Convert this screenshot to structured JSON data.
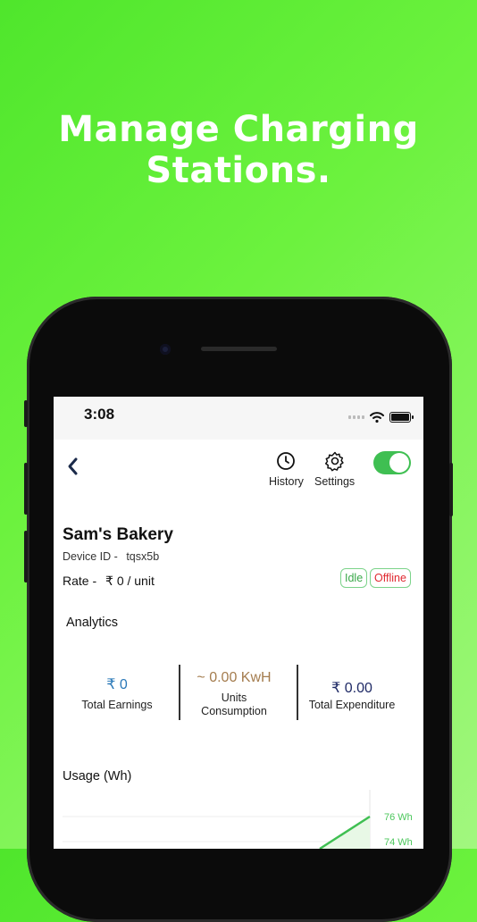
{
  "promo": {
    "headline_line1": "Manage Charging",
    "headline_line2": "Stations."
  },
  "status_bar": {
    "time": "3:08"
  },
  "toolbar": {
    "history_label": "History",
    "settings_label": "Settings",
    "power_on": true
  },
  "station": {
    "name": "Sam's Bakery",
    "device_id_label": "Device ID -",
    "device_id": "tqsx5b",
    "rate_label": "Rate -",
    "rate_value": "₹ 0 / unit",
    "badges": {
      "idle": "Idle",
      "offline": "Offline"
    }
  },
  "analytics": {
    "title": "Analytics",
    "earnings": {
      "value": "₹ 0",
      "label": "Total Earnings"
    },
    "units": {
      "value": "~ 0.00 KwH",
      "label_line1": "Units",
      "label_line2": "Consumption"
    },
    "expenditure": {
      "value": "₹ 0.00",
      "label": "Total Expenditure"
    }
  },
  "usage": {
    "title": "Usage (Wh)"
  },
  "colors": {
    "accent_green": "#3fbf52",
    "earnings_blue": "#2a78b8",
    "units_brown": "#a47c4e",
    "expenditure_navy": "#1f2a66",
    "offline_red": "#e0282f"
  },
  "chart_data": {
    "type": "area",
    "title": "Usage (Wh)",
    "y_tick_labels": [
      "76 Wh",
      "74 Wh"
    ],
    "series": [
      {
        "values": [
          74,
          76
        ]
      }
    ],
    "ylim": [
      74,
      76
    ],
    "grid": true
  }
}
